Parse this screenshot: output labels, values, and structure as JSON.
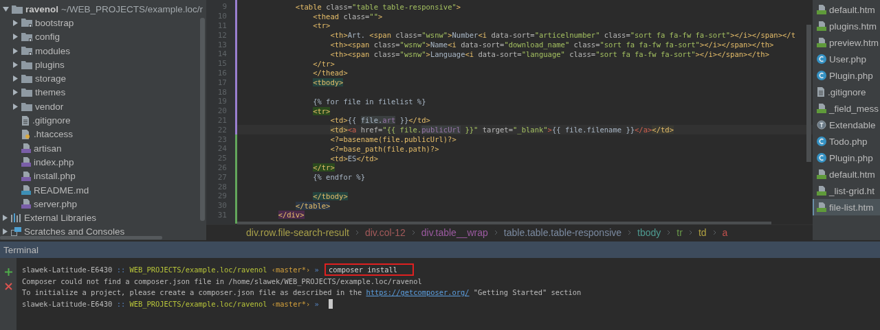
{
  "project_tree": {
    "root": {
      "label": "ravenol",
      "path": "~/WEB_PROJECTS/example.loc/r",
      "expanded": true,
      "children": [
        {
          "label": "bootstrap",
          "kind": "folder_lib",
          "expanded": false
        },
        {
          "label": "config",
          "kind": "folder_lib",
          "expanded": false
        },
        {
          "label": "modules",
          "kind": "folder_lib",
          "expanded": false
        },
        {
          "label": "plugins",
          "kind": "folder",
          "expanded": false
        },
        {
          "label": "storage",
          "kind": "folder",
          "expanded": false
        },
        {
          "label": "themes",
          "kind": "folder",
          "expanded": false
        },
        {
          "label": "vendor",
          "kind": "folder",
          "expanded": false
        },
        {
          "label": ".gitignore",
          "kind": "text"
        },
        {
          "label": ".htaccess",
          "kind": "config"
        },
        {
          "label": "artisan",
          "kind": "php"
        },
        {
          "label": "index.php",
          "kind": "php"
        },
        {
          "label": "install.php",
          "kind": "php"
        },
        {
          "label": "README.md",
          "kind": "md"
        },
        {
          "label": "server.php",
          "kind": "php"
        }
      ]
    },
    "others": [
      {
        "label": "External Libraries",
        "kind": "libraries",
        "expanded": false
      },
      {
        "label": "Scratches and Consoles",
        "kind": "scratches",
        "expanded": false
      }
    ]
  },
  "editor": {
    "lines": [
      {
        "number": "9",
        "current": false,
        "segments": [
          {
            "kind": "tag",
            "text": "            <table"
          },
          {
            "kind": "attr",
            "text": " class="
          },
          {
            "kind": "str",
            "text": "\"table table-responsive\""
          },
          {
            "kind": "tag",
            "text": ">"
          }
        ]
      },
      {
        "number": "10",
        "current": false,
        "segments": [
          {
            "kind": "tag",
            "text": "                <thead"
          },
          {
            "kind": "attr",
            "text": " class="
          },
          {
            "kind": "str",
            "text": "\"\""
          },
          {
            "kind": "tag",
            "text": ">"
          }
        ]
      },
      {
        "number": "11",
        "current": false,
        "segments": [
          {
            "kind": "tag",
            "text": "                <tr>"
          }
        ]
      },
      {
        "number": "12",
        "current": false,
        "segments": [
          {
            "kind": "tag",
            "text": "                    <th>"
          },
          {
            "kind": "text",
            "text": "Art. "
          },
          {
            "kind": "tag",
            "text": "<span"
          },
          {
            "kind": "attr",
            "text": " class="
          },
          {
            "kind": "str",
            "text": "\"wsnw\""
          },
          {
            "kind": "tag",
            "text": ">"
          },
          {
            "kind": "text",
            "text": "Number"
          },
          {
            "kind": "tag",
            "text": "<i"
          },
          {
            "kind": "attr",
            "text": " data-sort="
          },
          {
            "kind": "str",
            "text": "\"articelnumber\""
          },
          {
            "kind": "attr",
            "text": " class="
          },
          {
            "kind": "str",
            "text": "\"sort fa fa-fw fa-sort\""
          },
          {
            "kind": "tag",
            "text": "></i></span></t"
          }
        ]
      },
      {
        "number": "13",
        "current": false,
        "segments": [
          {
            "kind": "tag",
            "text": "                    <th><span"
          },
          {
            "kind": "attr",
            "text": " class="
          },
          {
            "kind": "str",
            "text": "\"wsnw\""
          },
          {
            "kind": "tag",
            "text": ">"
          },
          {
            "kind": "text",
            "text": "Name"
          },
          {
            "kind": "tag",
            "text": "<i"
          },
          {
            "kind": "attr",
            "text": " data-sort="
          },
          {
            "kind": "str",
            "text": "\"download_name\""
          },
          {
            "kind": "attr",
            "text": " class="
          },
          {
            "kind": "str",
            "text": "\"sort fa fa-fw fa-sort\""
          },
          {
            "kind": "tag",
            "text": "></i></span></th>"
          }
        ]
      },
      {
        "number": "14",
        "current": false,
        "segments": [
          {
            "kind": "tag",
            "text": "                    <th><span"
          },
          {
            "kind": "attr",
            "text": " class="
          },
          {
            "kind": "str",
            "text": "\"wsnw\""
          },
          {
            "kind": "tag",
            "text": ">"
          },
          {
            "kind": "text",
            "text": "Language"
          },
          {
            "kind": "tag",
            "text": "<i"
          },
          {
            "kind": "attr",
            "text": " data-sort="
          },
          {
            "kind": "str",
            "text": "\"language\""
          },
          {
            "kind": "attr",
            "text": " class="
          },
          {
            "kind": "str",
            "text": "\"sort fa fa-fw fa-sort\""
          },
          {
            "kind": "tag",
            "text": "></i></span></th>"
          }
        ]
      },
      {
        "number": "15",
        "current": false,
        "segments": [
          {
            "kind": "tag",
            "text": "                </tr>"
          }
        ]
      },
      {
        "number": "16",
        "current": false,
        "segments": [
          {
            "kind": "tag",
            "text": "                </thead>"
          }
        ]
      },
      {
        "number": "17",
        "current": false,
        "segments": [
          {
            "kind": "tag_teal",
            "text": "                <tbody>"
          }
        ]
      },
      {
        "number": "18",
        "current": false
      },
      {
        "number": "19",
        "current": false,
        "segments": [
          {
            "kind": "text",
            "text": "                {% for file in filelist %}"
          }
        ]
      },
      {
        "number": "20",
        "current": false,
        "segments": [
          {
            "kind": "tag_green",
            "text": "                <tr>"
          }
        ]
      },
      {
        "number": "21",
        "current": false,
        "segments": [
          {
            "kind": "tag",
            "text": "                    <td>"
          },
          {
            "kind": "text",
            "text": "{{"
          },
          {
            "kind": "var",
            "text": " file."
          },
          {
            "kind": "prop",
            "text": "art"
          },
          {
            "kind": "text",
            "text": " }}"
          },
          {
            "kind": "tag",
            "text": "</td>"
          }
        ]
      },
      {
        "number": "22",
        "current": true,
        "segments": [
          {
            "kind": "tag_match",
            "text": "                    <td>"
          },
          {
            "kind": "tag_red",
            "text": "<a"
          },
          {
            "kind": "attr",
            "text": " href="
          },
          {
            "kind": "str",
            "text": "\"{{ file."
          },
          {
            "kind": "prop",
            "text": "publicUrl"
          },
          {
            "kind": "str",
            "text": " }}\""
          },
          {
            "kind": "attr",
            "text": " target="
          },
          {
            "kind": "str",
            "text": "\"_blank\""
          },
          {
            "kind": "tag_red",
            "text": ">"
          },
          {
            "kind": "text",
            "text": "{{ file.filename }}"
          },
          {
            "kind": "tag_red",
            "text": "</a>"
          },
          {
            "kind": "tag_match",
            "text": "</td>"
          }
        ]
      },
      {
        "number": "23",
        "current": false,
        "segments": [
          {
            "kind": "tag",
            "text": "                    <?=basename(file.publicUrl)?>"
          }
        ]
      },
      {
        "number": "24",
        "current": false,
        "segments": [
          {
            "kind": "tag",
            "text": "                    <?=base_path(file.path)?>"
          }
        ]
      },
      {
        "number": "25",
        "current": false,
        "segments": [
          {
            "kind": "tag",
            "text": "                    <td>"
          },
          {
            "kind": "text",
            "text": "ES"
          },
          {
            "kind": "tag",
            "text": "</td>"
          }
        ]
      },
      {
        "number": "26",
        "current": false,
        "segments": [
          {
            "kind": "tag_green",
            "text": "                </tr>"
          }
        ]
      },
      {
        "number": "27",
        "current": false,
        "segments": [
          {
            "kind": "text",
            "text": "                {% endfor %}"
          }
        ]
      },
      {
        "number": "28",
        "current": false
      },
      {
        "number": "29",
        "current": false,
        "segments": [
          {
            "kind": "tag_teal",
            "text": "                </tbody>"
          }
        ]
      },
      {
        "number": "30",
        "current": false,
        "segments": [
          {
            "kind": "tag_blue",
            "text": "            </table>"
          }
        ]
      },
      {
        "number": "31",
        "current": false,
        "segments": [
          {
            "kind": "tag_purple",
            "text": "        </div>"
          }
        ]
      }
    ],
    "breadcrumbs": [
      {
        "label": "div.row.file-search-result",
        "color": "#a8a04a"
      },
      {
        "label": "div.col-12",
        "color": "#a35a5a"
      },
      {
        "label": "div.table__wrap",
        "color": "#9b5aa0"
      },
      {
        "label": "table.table.table-responsive",
        "color": "#7b8aa0"
      },
      {
        "label": "tbody",
        "color": "#4e9a90"
      },
      {
        "label": "tr",
        "color": "#6a9a4a"
      },
      {
        "label": "td",
        "color": "#b0a040"
      },
      {
        "label": "a",
        "color": "#c0504d"
      }
    ]
  },
  "recent_files": [
    {
      "label": "default.htm",
      "kind": "html",
      "selected": false
    },
    {
      "label": "plugins.htm",
      "kind": "html",
      "selected": false
    },
    {
      "label": "preview.htm",
      "kind": "html",
      "selected": false
    },
    {
      "label": "User.php",
      "kind": "class",
      "selected": false
    },
    {
      "label": "Plugin.php",
      "kind": "class",
      "selected": false
    },
    {
      "label": ".gitignore",
      "kind": "text",
      "selected": false
    },
    {
      "label": "_field_mess",
      "kind": "html",
      "selected": false
    },
    {
      "label": "Extendable",
      "kind": "trait",
      "selected": false
    },
    {
      "label": "Todo.php",
      "kind": "class",
      "selected": false
    },
    {
      "label": "Plugin.php",
      "kind": "class",
      "selected": false
    },
    {
      "label": "default.htm",
      "kind": "html",
      "selected": false
    },
    {
      "label": "_list-grid.ht",
      "kind": "html",
      "selected": false
    },
    {
      "label": "file-list.htm",
      "kind": "html",
      "selected": true
    }
  ],
  "terminal": {
    "title": "Terminal",
    "lines": [
      {
        "cursor": false,
        "segments": [
          {
            "kind": "host",
            "text": "slawek-Latitude-E6430"
          },
          {
            "kind": "sep",
            "text": " :: "
          },
          {
            "kind": "path",
            "text": "WEB_PROJECTS/example.loc/ravenol"
          },
          {
            "kind": "branch",
            "text": " ‹master*›"
          },
          {
            "kind": "sep",
            "text": " » "
          },
          {
            "kind": "command",
            "text": "composer install"
          }
        ]
      },
      {
        "cursor": false,
        "segments": [
          {
            "kind": "host",
            "text": "Composer could not find a composer.json file in /home/slawek/WEB_PROJECTS/example.loc/ravenol"
          }
        ]
      },
      {
        "cursor": false,
        "segments": [
          {
            "kind": "host",
            "text": "To initialize a project, please create a composer.json file as described in the "
          },
          {
            "kind": "link",
            "text": "https://getcomposer.org/"
          },
          {
            "kind": "host",
            "text": " \"Getting Started\" section"
          }
        ]
      },
      {
        "cursor": true,
        "segments": [
          {
            "kind": "host",
            "text": "slawek-Latitude-E6430"
          },
          {
            "kind": "sep",
            "text": " :: "
          },
          {
            "kind": "path",
            "text": "WEB_PROJECTS/example.loc/ravenol"
          },
          {
            "kind": "branch",
            "text": " ‹master*›"
          },
          {
            "kind": "sep",
            "text": " » "
          }
        ]
      }
    ]
  }
}
